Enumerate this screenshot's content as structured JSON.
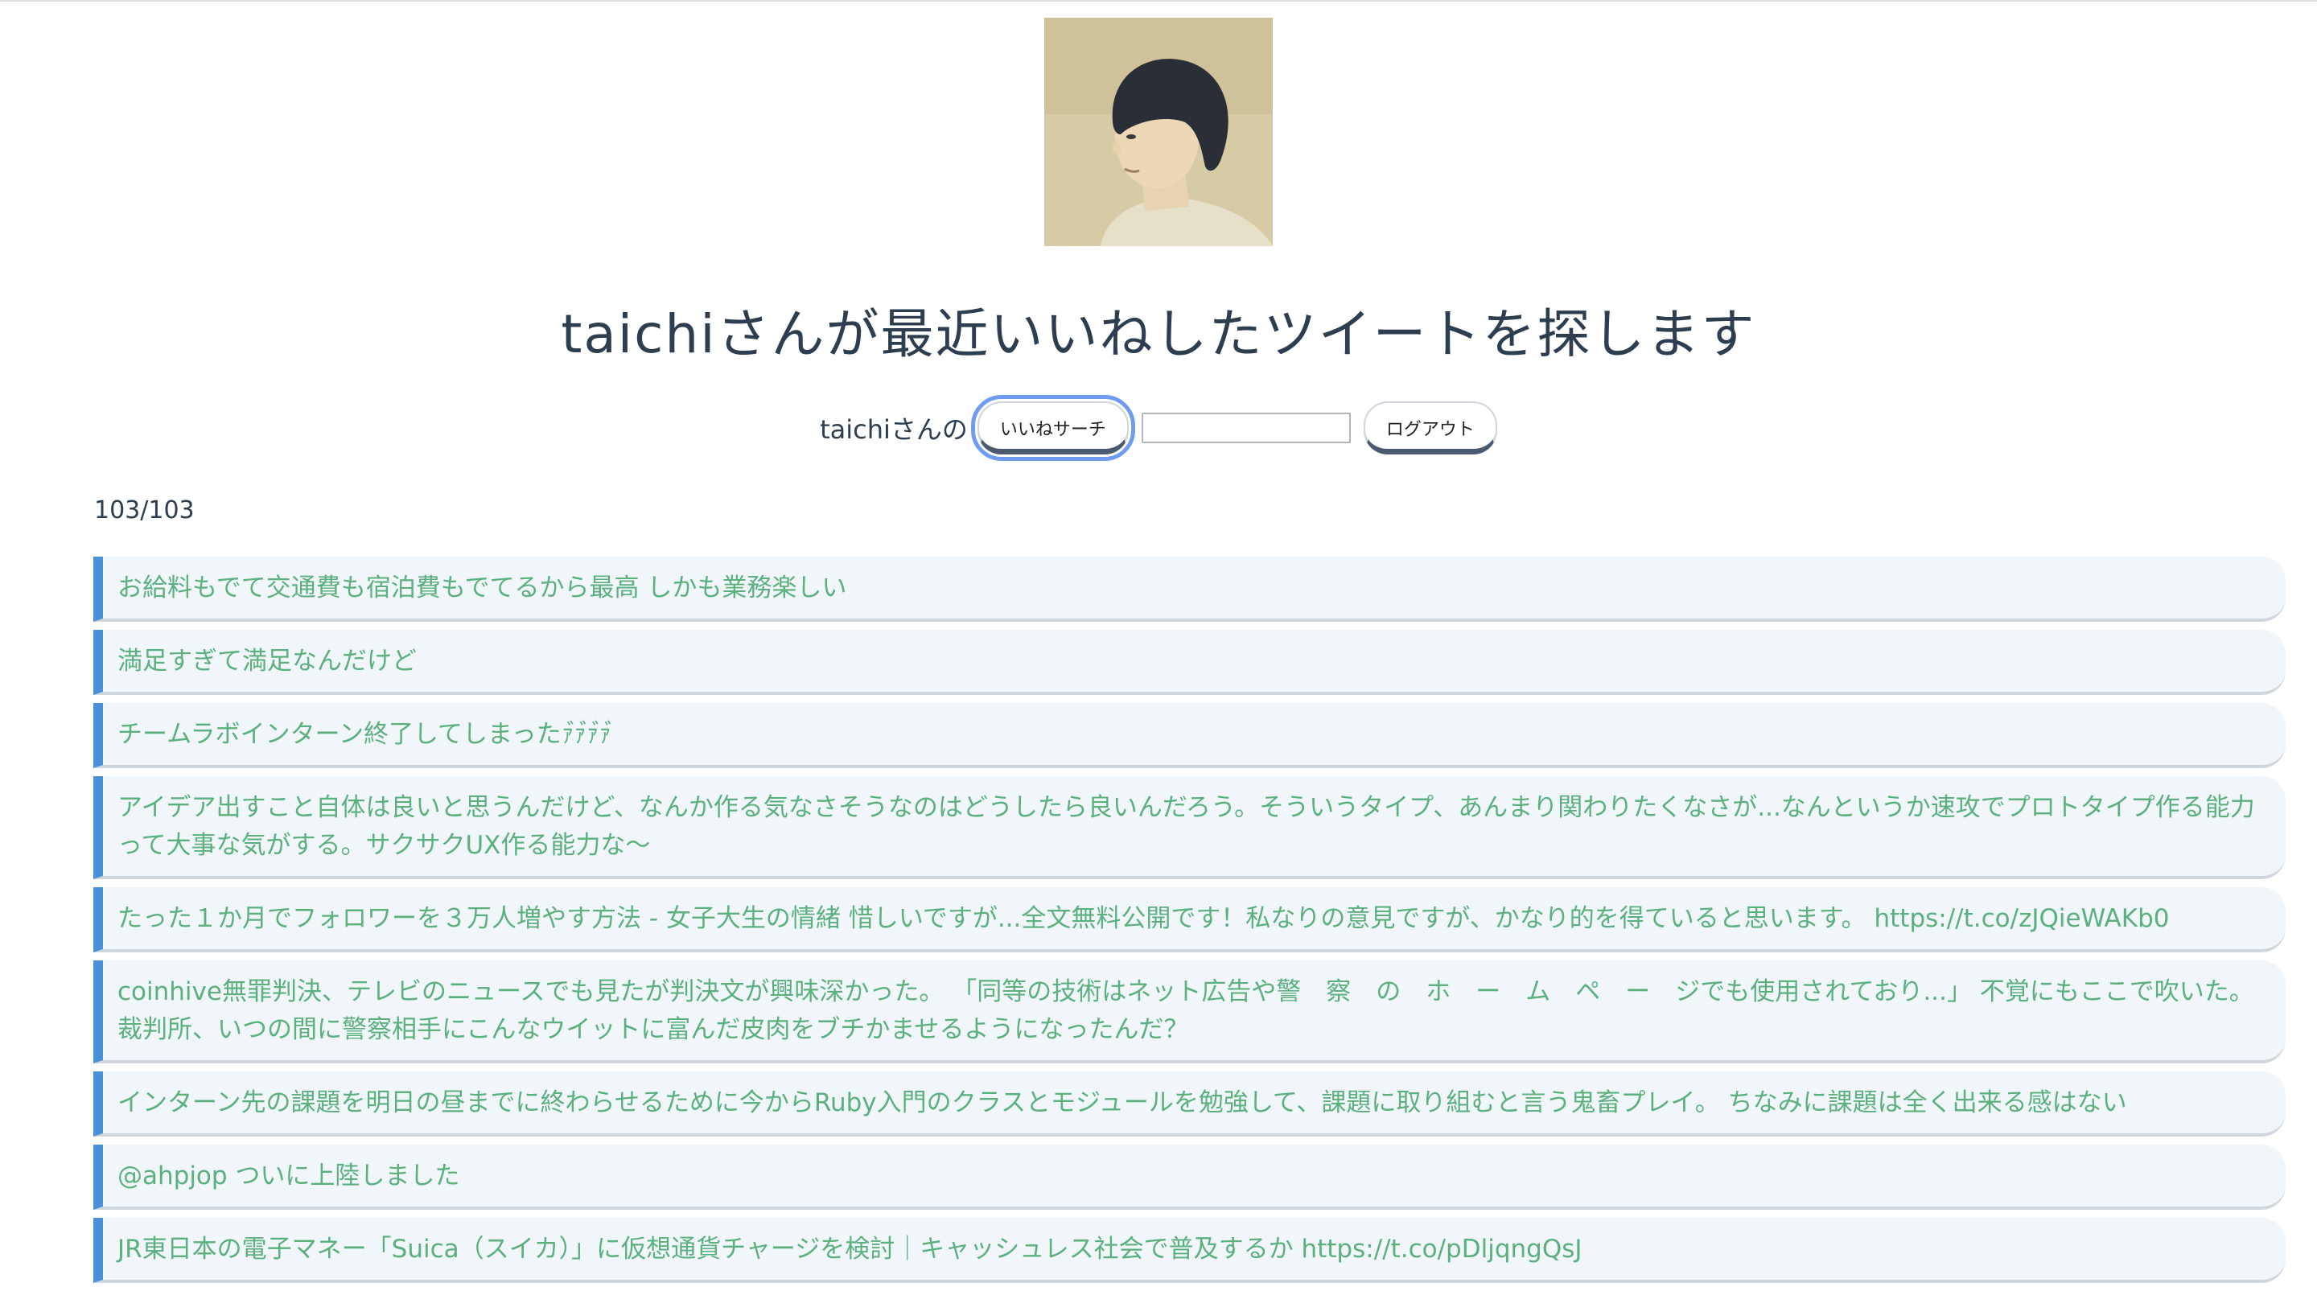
{
  "header": {
    "avatar_alt": "taichi profile image",
    "title": "taichiさんが最近いいねしたツイートを探します"
  },
  "search": {
    "label": "taichiさんの",
    "search_button": "いいねサーチ",
    "input_value": "",
    "input_placeholder": "",
    "logout_button": "ログアウト"
  },
  "results": {
    "count": "103/103",
    "tweets": [
      "お給料もでて交通費も宿泊費もでてるから最高 しかも業務楽しい",
      "満足すぎて満足なんだけど",
      "チームラボインターン終了してしまったｧ゙ｧ゙ｧ゙ｧ゙",
      "アイデア出すこと自体は良いと思うんだけど、なんか作る気なさそうなのはどうしたら良いんだろう。そういうタイプ、あんまり関わりたくなさが...なんというか速攻でプロトタイプ作る能力って大事な気がする。サクサクUX作る能力な〜",
      "たった１か月でフォロワーを３万人増やす方法 - 女子大生の情緒 惜しいですが...全文無料公開です！私なりの意見ですが、かなり的を得ていると思います。 https://t.co/zJQieWAKb0",
      "coinhive無罪判決、テレビのニュースでも見たが判決文が興味深かった。 「同等の技術はネット広告や警　察　の　ホ　ー　ム　ペ　ー　ジでも使用されており...」 不覚にもここで吹いた。 裁判所、いつの間に警察相手にこんなウイットに富んだ皮肉をブチかませるようになったんだ？",
      "インターン先の課題を明日の昼までに終わらせるために今からRuby入門のクラスとモジュールを勉強して、課題に取り組むと言う鬼畜プレイ。 ちなみに課題は全く出来る感はない",
      "@ahpjop ついに上陸しました",
      "JR東日本の電子マネー「Suica（スイカ）」に仮想通貨チャージを検討｜キャッシュレス社会で普及するか https://t.co/pDljqngQsJ"
    ]
  },
  "colors": {
    "accent_border": "#4a90d9",
    "tweet_text": "#5bb07d",
    "tweet_bg": "#f1f6fb",
    "focus_ring": "#6f9cf0"
  }
}
